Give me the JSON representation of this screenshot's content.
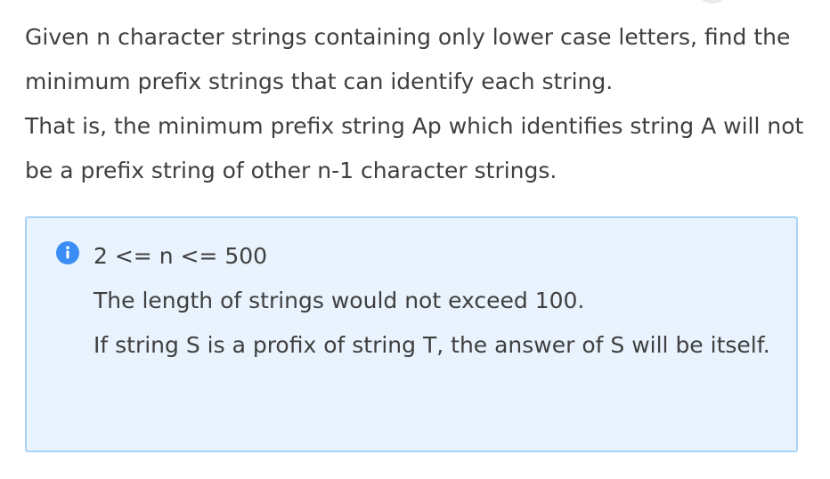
{
  "description": {
    "paragraph_1": "Given n character strings containing only lower case letters, find the minimum prefix strings that can identify each string.",
    "paragraph_2": "That is, the minimum prefix string Ap which identifies string A will not be a prefix string of other n-1 character strings."
  },
  "notice": {
    "icon": "info-icon",
    "accent_color": "#3b8df5",
    "background_color": "#e8f3fd",
    "border_color": "#a9d3f6",
    "lines": [
      "2 <= n <= 500",
      "The length of strings would not exceed 100.",
      "If string S is a profix of string T, the answer of S will be itself."
    ]
  }
}
